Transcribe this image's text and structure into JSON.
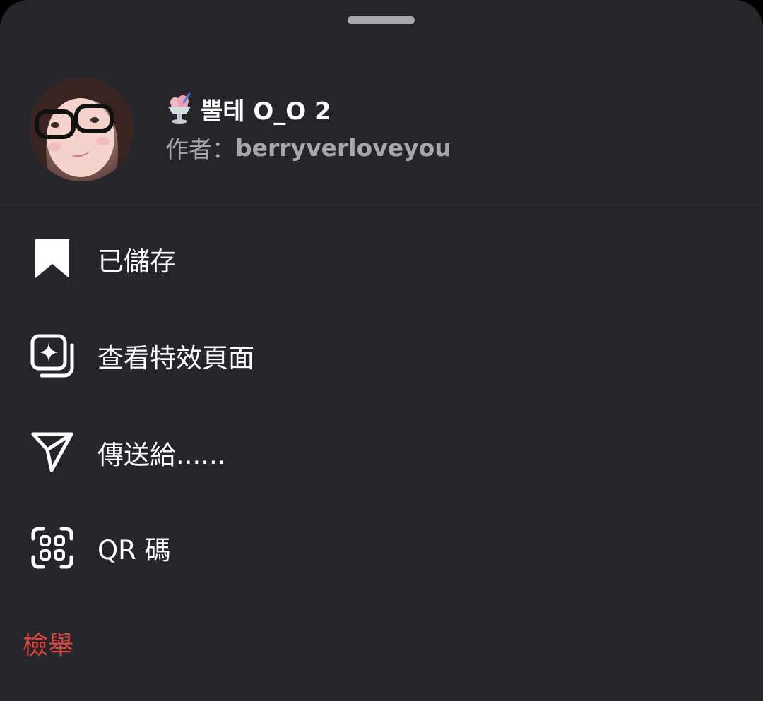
{
  "effect": {
    "emoji": "shaved-ice-emoji",
    "name": "뿔테 O_O 2",
    "author_prefix": "作者：",
    "author": "berryverloveyou"
  },
  "menu": {
    "items": [
      {
        "icon": "bookmark-filled-icon",
        "label": "已儲存"
      },
      {
        "icon": "effect-sparkle-icon",
        "label": "查看特效頁面"
      },
      {
        "icon": "send-paper-plane-icon",
        "label": "傳送給......"
      },
      {
        "icon": "qr-scan-icon",
        "label": "QR 碼"
      }
    ],
    "report_label": "檢舉"
  },
  "colors": {
    "background": "#25262b",
    "text": "#ffffff",
    "secondary_text": "#a6a8ad",
    "danger": "#e0453e"
  }
}
